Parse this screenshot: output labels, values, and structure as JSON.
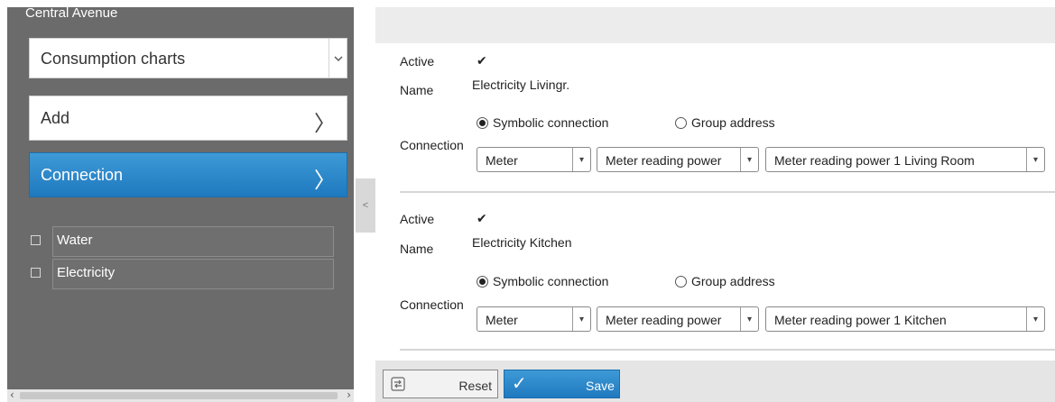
{
  "sidebar": {
    "title": "Central Avenue",
    "dropdown": {
      "value": "Consumption charts"
    },
    "nav": [
      {
        "label": "Add",
        "active": false
      },
      {
        "label": "Connection",
        "active": true
      }
    ],
    "tree": [
      {
        "label": "Water",
        "checked": false
      },
      {
        "label": "Electricity",
        "checked": false
      }
    ],
    "collapse_glyph": "<"
  },
  "labels": {
    "active": "Active",
    "name": "Name",
    "connection": "Connection",
    "symbolic": "Symbolic connection",
    "group": "Group address"
  },
  "entries": [
    {
      "active": true,
      "name": "Electricity Livingr.",
      "connection_type": "Symbolic connection",
      "select1": "Meter",
      "select2": "Meter reading power",
      "select3": "Meter reading power 1 Living Room"
    },
    {
      "active": true,
      "name": "Electricity Kitchen",
      "connection_type": "Symbolic connection",
      "select1": "Meter",
      "select2": "Meter reading power",
      "select3": "Meter reading power 1 Kitchen"
    }
  ],
  "toolbar": {
    "reset_label": "Reset",
    "save_label": "Save"
  },
  "colors": {
    "sidebar_bg": "#6b6b6b",
    "accent": "#2a86c9",
    "topbar": "#ececec"
  }
}
